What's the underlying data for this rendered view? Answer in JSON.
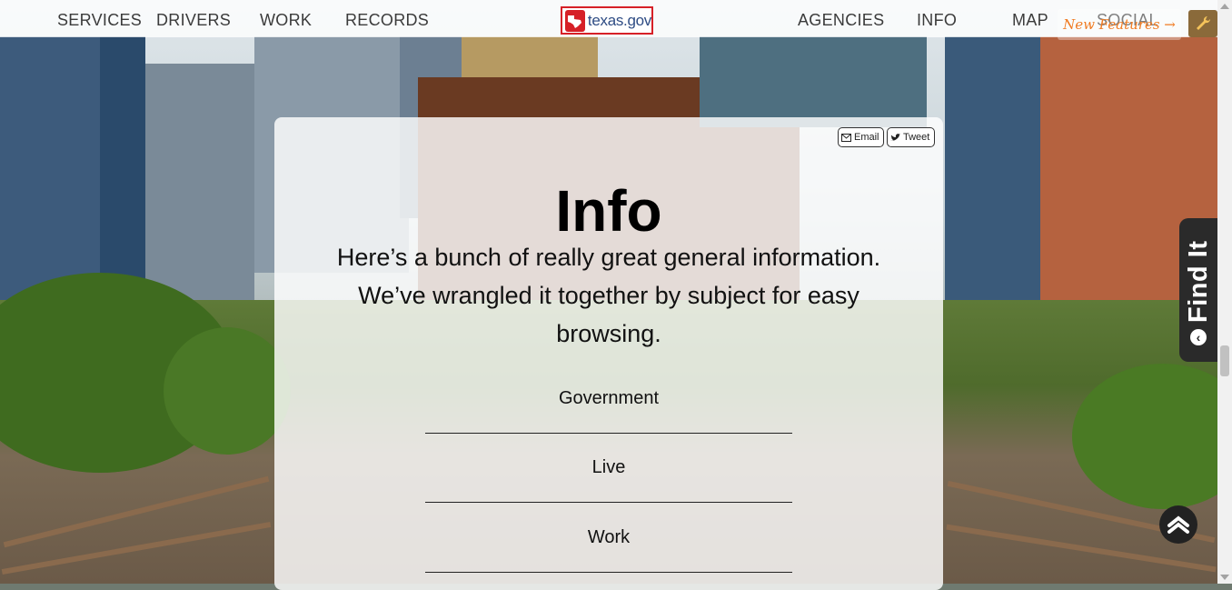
{
  "nav": {
    "left": [
      "SERVICES",
      "DRIVERS",
      "WORK",
      "RECORDS"
    ],
    "logo_text": "texas.gov",
    "right": [
      "AGENCIES",
      "INFO",
      "MAP",
      "SOCIAL"
    ],
    "new_features": "New Features →"
  },
  "share": {
    "email": "Email",
    "tweet": "Tweet"
  },
  "main": {
    "title": "Info",
    "intro": "Here’s a bunch of really great general information. We’ve wrangled it together by subject for easy browsing.",
    "categories": [
      "Government",
      "Live",
      "Work"
    ]
  },
  "find_it": {
    "label": "Find It"
  },
  "colors": {
    "logo_red": "#d62027",
    "logo_blue": "#2e4c84",
    "new_features_orange": "#f07b22",
    "find_it_bg": "#2a2a2a"
  },
  "icons": [
    "texas-flag-icon",
    "wrench-icon",
    "envelope-icon",
    "twitter-bird-icon",
    "chevron-left-icon",
    "chevron-up-icon"
  ]
}
